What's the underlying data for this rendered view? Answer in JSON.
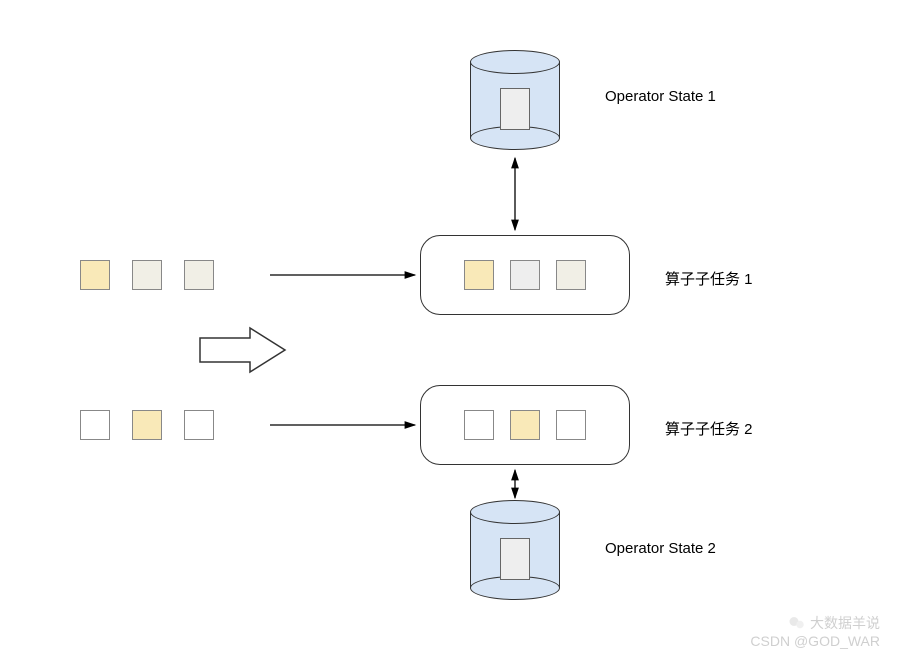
{
  "labels": {
    "state1": "Operator State 1",
    "state2": "Operator State 2",
    "subtask1": "算子子任务 1",
    "subtask2": "算子子任务 2"
  },
  "colors": {
    "db_fill": "#d6e4f5",
    "yellow": "#f9e9b8",
    "beige": "#f1efe6",
    "gray": "#eeeeee",
    "white": "#ffffff"
  },
  "stream1_boxes": [
    "yellow",
    "beige",
    "beige"
  ],
  "stream2_boxes": [
    "white",
    "yellow",
    "white"
  ],
  "subtask1_boxes": [
    "yellow",
    "gray",
    "beige"
  ],
  "subtask2_boxes": [
    "white",
    "yellow",
    "white"
  ],
  "watermark": {
    "line1": "大数据羊说",
    "line2": "CSDN @GOD_WAR"
  }
}
